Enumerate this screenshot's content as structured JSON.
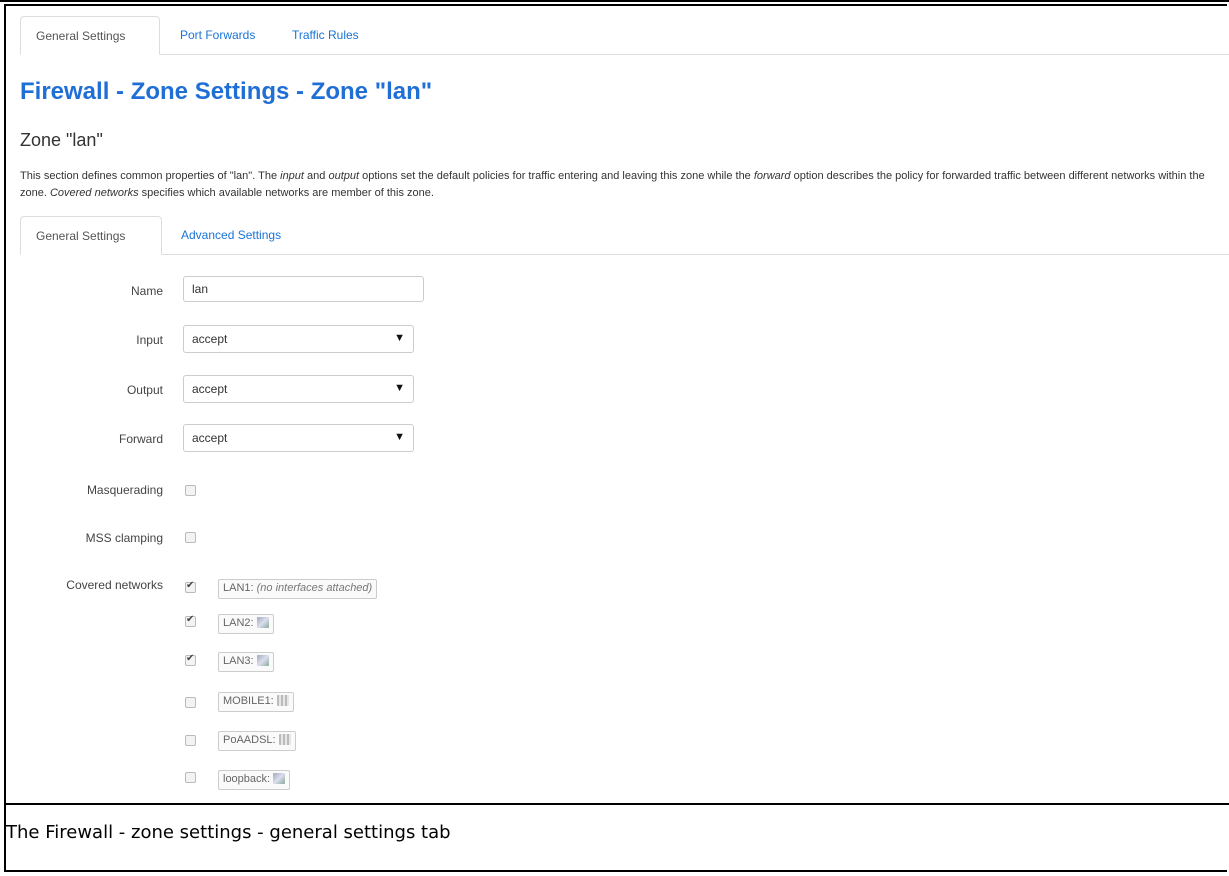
{
  "top_tabs": [
    "General Settings",
    "Port Forwards",
    "Traffic Rules"
  ],
  "page_title": "Firewall - Zone Settings - Zone \"lan\"",
  "section_title": "Zone \"lan\"",
  "description": {
    "p1": "This section defines common properties of \"lan\". The ",
    "input_word": "input",
    "p2": " and ",
    "output_word": "output",
    "p3": " options set the default policies for traffic entering and leaving this zone while the ",
    "forward_word": "forward",
    "p4": " option describes the policy for forwarded traffic between different networks within the zone. ",
    "covered_word": "Covered networks",
    "p5": " specifies which available networks are member of this zone."
  },
  "sub_tabs": [
    "General Settings",
    "Advanced Settings"
  ],
  "form": {
    "name_label": "Name",
    "name_value": "lan",
    "input_label": "Input",
    "input_value": "accept",
    "output_label": "Output",
    "output_value": "accept",
    "forward_label": "Forward",
    "forward_value": "accept",
    "masq_label": "Masquerading",
    "mss_label": "MSS clamping",
    "covered_label": "Covered networks"
  },
  "networks": [
    {
      "name": "LAN1:",
      "note": "(no interfaces attached)",
      "checked": true,
      "icon": "none"
    },
    {
      "name": "LAN2:",
      "checked": true,
      "icon": "ethernet-icon"
    },
    {
      "name": "LAN3:",
      "checked": true,
      "icon": "ethernet-icon"
    },
    {
      "name": "MOBILE1:",
      "checked": false,
      "icon": "mobile-icon"
    },
    {
      "name": "PoAADSL:",
      "checked": false,
      "icon": "mobile-icon"
    },
    {
      "name": "loopback:",
      "checked": false,
      "icon": "ethernet-icon"
    }
  ],
  "caption": "The Firewall - zone settings - general settings tab"
}
